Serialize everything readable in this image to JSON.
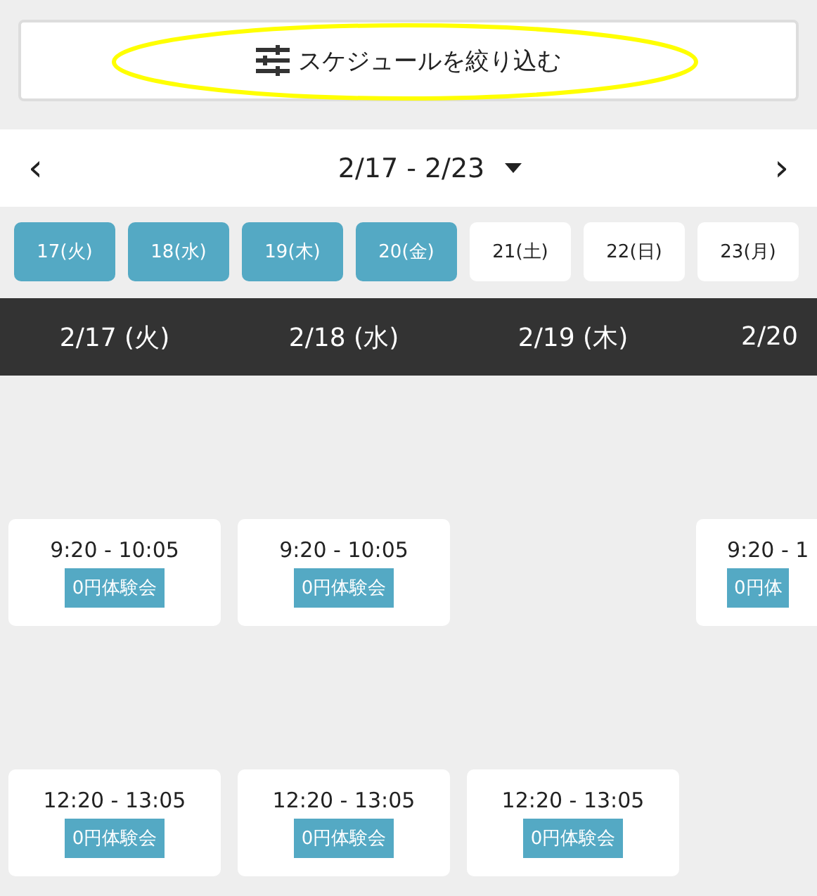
{
  "filter_button": {
    "label": "スケジュールを絞り込む"
  },
  "annotation": {
    "kind": "ellipse",
    "color": "#ffff00"
  },
  "week_nav": {
    "prev": "‹",
    "range": "2/17 - 2/23",
    "next": "›"
  },
  "day_chips": [
    {
      "label": "17(火)",
      "selected": true
    },
    {
      "label": "18(水)",
      "selected": true
    },
    {
      "label": "19(木)",
      "selected": true
    },
    {
      "label": "20(金)",
      "selected": true
    },
    {
      "label": "21(土)",
      "selected": false
    },
    {
      "label": "22(日)",
      "selected": false
    },
    {
      "label": "23(月)",
      "selected": false
    }
  ],
  "columns": [
    {
      "date": "2/17 (火)",
      "cut": false,
      "slots": [
        {
          "kind": "session",
          "time": "9:20 - 10:05",
          "tag": "0円体験会"
        },
        {
          "kind": "session",
          "time": "12:20 - 13:05",
          "tag": "0円体験会"
        }
      ]
    },
    {
      "date": "2/18 (水)",
      "cut": false,
      "slots": [
        {
          "kind": "session",
          "time": "9:20 - 10:05",
          "tag": "0円体験会"
        },
        {
          "kind": "session",
          "time": "12:20 - 13:05",
          "tag": "0円体験会"
        }
      ]
    },
    {
      "date": "2/19 (木)",
      "cut": false,
      "slots": [
        {
          "kind": "empty"
        },
        {
          "kind": "session",
          "time": "12:20 - 13:05",
          "tag": "0円体験会"
        }
      ]
    },
    {
      "date": "2/20",
      "cut": true,
      "slots": [
        {
          "kind": "session",
          "time": "9:20 - 1",
          "tag": "0円体"
        },
        {
          "kind": "empty"
        }
      ]
    }
  ]
}
